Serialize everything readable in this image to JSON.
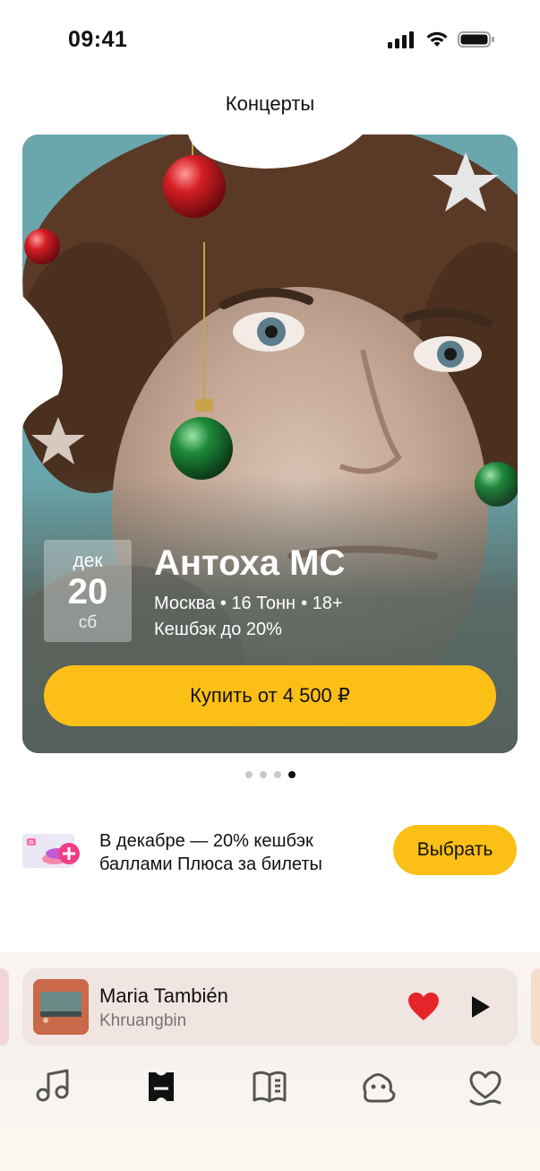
{
  "status_bar": {
    "time": "09:41"
  },
  "header": {
    "title": "Концерты"
  },
  "concert": {
    "date": {
      "month": "дек",
      "day": "20",
      "weekday": "сб"
    },
    "artist": "Антоха МС",
    "city_venue": "Москва • 16 Тонн",
    "age": "• 18+",
    "cashback": "Кешбэк до 20%",
    "buy_label": "Купить от 4 500 ₽"
  },
  "pager": {
    "count": 4,
    "active_index": 3
  },
  "promo": {
    "text": "В декабре — 20% кешбэк баллами Плюса за билеты",
    "button_label": "Выбрать"
  },
  "player": {
    "title": "Maria También",
    "artist": "Khruangbin",
    "liked": true
  },
  "bottom_nav": {
    "items": [
      {
        "icon": "music-note-icon"
      },
      {
        "icon": "ticket-icon",
        "active": true
      },
      {
        "icon": "book-icon"
      },
      {
        "icon": "kids-icon"
      },
      {
        "icon": "heart-wave-icon"
      }
    ]
  },
  "colors": {
    "accent": "#fcbf16",
    "like": "#e4262b",
    "text": "#111111"
  }
}
